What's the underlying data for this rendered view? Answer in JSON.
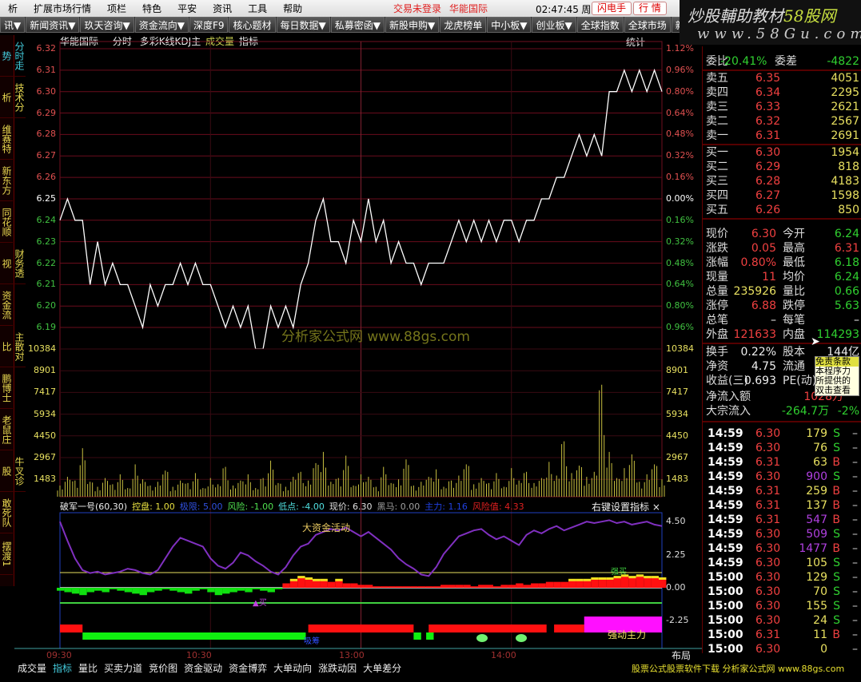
{
  "menubar": {
    "items": [
      "析",
      "扩展市场行情",
      "项栏",
      "特色",
      "平安",
      "资讯",
      "工具",
      "帮助"
    ],
    "status": "交易未登录",
    "stock": "华能国际",
    "time": "02:47:45",
    "weekday": "周日",
    "btn_flash": "闪电手",
    "btn_quote": "行 情"
  },
  "toolbar": {
    "items": [
      "讯▼",
      "新闻资讯▼",
      "玖天咨询▼",
      "资金流向▼",
      "深度F9",
      "核心题材",
      "每日数据▼",
      "私募密函▼",
      "新股申购▼",
      "龙虎榜单",
      "中小板▼",
      "创业板▼",
      "全球指数",
      "全球市场",
      "新"
    ]
  },
  "watermark": {
    "line1a": "炒股輔助教材",
    "line1b": "58股网",
    "line2": "www.58Gu.com"
  },
  "sidebar": [
    "分时走势",
    "技术分析",
    "维赛特",
    "新东方",
    "同花顺",
    "财务透视",
    "资金流",
    "主散对比",
    "鹏博士",
    "老鼠庄",
    "牛叉诊股",
    "敢死队",
    "摆渡1"
  ],
  "chart_header": {
    "name": "华能国际",
    "mode": "分时",
    "kline": "多彩K线KDJ主",
    "volume": "成交量",
    "indicator": "指标",
    "stats": "统计"
  },
  "chart_data": [
    {
      "type": "line",
      "title": "华能国际 分时",
      "prev_close": 6.25,
      "ylim": [
        6.18,
        6.32
      ],
      "price_ticks": [
        "6.32",
        "6.31",
        "6.30",
        "6.29",
        "6.28",
        "6.27",
        "6.26",
        "6.25",
        "6.24",
        "6.23",
        "6.22",
        "6.21",
        "6.20",
        "6.19"
      ],
      "pct_ticks": [
        "1.12%",
        "0.96%",
        "0.80%",
        "0.64%",
        "0.48%",
        "0.32%",
        "0.16%",
        "0.00%",
        "0.16%",
        "0.32%",
        "0.48%",
        "0.64%",
        "0.80%",
        "0.96%"
      ],
      "minutes_step": 3,
      "prices": [
        6.24,
        6.25,
        6.24,
        6.24,
        6.21,
        6.23,
        6.21,
        6.22,
        6.21,
        6.21,
        6.2,
        6.19,
        6.21,
        6.2,
        6.21,
        6.21,
        6.22,
        6.21,
        6.22,
        6.21,
        6.21,
        6.2,
        6.19,
        6.2,
        6.19,
        6.2,
        6.18,
        6.18,
        6.2,
        6.19,
        6.2,
        6.19,
        6.21,
        6.22,
        6.24,
        6.25,
        6.23,
        6.23,
        6.22,
        6.24,
        6.23,
        6.25,
        6.23,
        6.24,
        6.22,
        6.23,
        6.22,
        6.22,
        6.21,
        6.22,
        6.22,
        6.22,
        6.23,
        6.24,
        6.23,
        6.24,
        6.23,
        6.24,
        6.23,
        6.24,
        6.24,
        6.23,
        6.24,
        6.24,
        6.25,
        6.25,
        6.26,
        6.26,
        6.27,
        6.28,
        6.27,
        6.28,
        6.27,
        6.3,
        6.3,
        6.31,
        6.3,
        6.31,
        6.3,
        6.31,
        6.3
      ],
      "x_ticks": [
        "09:30",
        "10:30",
        "13:00",
        "14:00"
      ]
    },
    {
      "type": "bar",
      "title": "成交量",
      "ylim": [
        0,
        11867
      ],
      "ticks": [
        "10384",
        "8901",
        "7417",
        "5934",
        "4450",
        "2967",
        "1483"
      ],
      "values": [
        900,
        1600,
        1300,
        3900,
        1200,
        800,
        1500,
        1000,
        1800,
        700,
        2600,
        1400,
        900,
        1200,
        2100,
        800,
        1300,
        1100,
        1900,
        700,
        1500,
        1000,
        2400,
        900,
        1300,
        1800,
        700,
        1500,
        2900,
        1100,
        800,
        1600,
        2000,
        1300,
        2700,
        3600,
        1200,
        1500,
        3300,
        900,
        1800,
        1600,
        800,
        2400,
        1100,
        1400,
        3000,
        900,
        1200,
        1600,
        2200,
        800,
        1300,
        1700,
        2600,
        1000,
        1500,
        1100,
        1900,
        800,
        2300,
        1300,
        2000,
        1100,
        1500,
        2800,
        1700,
        4450,
        1900,
        2500,
        1600,
        2000,
        9000,
        3600,
        1500,
        2300,
        3400,
        1200,
        1800,
        2600,
        1400
      ]
    },
    {
      "type": "line",
      "title": "破军一号(60,30)",
      "ylim": [
        -3,
        5
      ],
      "ticks": [
        "4.50",
        "2.25",
        "0.00",
        "-2.25"
      ],
      "legend": [
        {
          "k": "控盘",
          "v": "1.00",
          "c": "#e8e040"
        },
        {
          "k": "极限",
          "v": "5.00",
          "c": "#3050e0"
        },
        {
          "k": "风险",
          "v": "-1.00",
          "c": "#50e050"
        },
        {
          "k": "低点",
          "v": "-4.00",
          "c": "#50e0e0"
        },
        {
          "k": "现价",
          "v": "6.30",
          "c": "#e0e0e0"
        },
        {
          "k": "黑马",
          "v": "0.00",
          "c": "#a0a0a0"
        },
        {
          "k": "主力",
          "v": "1.16",
          "c": "#2040e0"
        },
        {
          "k": "风险值",
          "v": "4.33",
          "c": "#e02020"
        }
      ],
      "right_hint": "右键设置指标 ×",
      "line": [
        4.5,
        3.2,
        2.0,
        1.2,
        1.0,
        1.1,
        0.9,
        1.0,
        1.1,
        1.3,
        1.2,
        1.0,
        0.9,
        1.2,
        2.0,
        2.8,
        3.4,
        3.2,
        3.0,
        2.8,
        2.0,
        1.5,
        1.3,
        1.7,
        2.4,
        2.2,
        1.8,
        1.5,
        1.1,
        0.9,
        1.4,
        2.2,
        2.8,
        3.0,
        3.6,
        3.8,
        4.0,
        3.9,
        4.1,
        3.8,
        3.5,
        3.8,
        3.4,
        3.0,
        2.6,
        2.0,
        1.6,
        1.3,
        0.9,
        0.8,
        1.4,
        2.3,
        2.9,
        3.5,
        3.7,
        3.9,
        4.0,
        3.6,
        3.3,
        3.5,
        3.2,
        2.9,
        3.6,
        3.9,
        3.7,
        4.0,
        4.2,
        3.9,
        4.1,
        4.3,
        4.5,
        4.4,
        4.5,
        4.6,
        4.4,
        4.5,
        4.3,
        4.4,
        4.5,
        4.3,
        4.2
      ],
      "fund": [
        -0.2,
        -0.3,
        -0.4,
        -0.5,
        -0.3,
        -0.2,
        -0.3,
        -0.1,
        -0.2,
        -0.3,
        -0.4,
        -0.5,
        -0.3,
        -0.2,
        -0.1,
        -0.2,
        -0.3,
        -0.4,
        -0.2,
        -0.1,
        -0.3,
        -0.5,
        -0.4,
        -0.3,
        -0.2,
        -0.3,
        -0.1,
        -0.2,
        -0.3,
        -0.1,
        0.3,
        0.5,
        0.7,
        0.6,
        0.5,
        0.5,
        0.4,
        0.5,
        0.3,
        0.3,
        0.2,
        0.2,
        0.1,
        0.1,
        0.1,
        0.1,
        0.1,
        0.1,
        0.1,
        0.1,
        0.1,
        0.2,
        0.2,
        0.2,
        0.2,
        0.1,
        0.2,
        0.2,
        0.1,
        0.2,
        0.2,
        0.3,
        0.2,
        0.3,
        0.3,
        0.4,
        0.4,
        0.4,
        0.5,
        0.5,
        0.5,
        0.6,
        0.6,
        0.6,
        0.7,
        0.8,
        0.7,
        0.8,
        0.7,
        0.7,
        0.6
      ],
      "band_top": [
        {
          "from": 0,
          "to": 9,
          "color": "#ff1010"
        },
        {
          "from": 99,
          "to": 141,
          "color": "#ff1010"
        },
        {
          "from": 147,
          "to": 194,
          "color": "#ff1010"
        },
        {
          "from": 197,
          "to": 209,
          "color": "#ff1010"
        },
        {
          "from": 209,
          "to": 240,
          "color": "#ff10ff"
        }
      ],
      "band_bottom": [
        {
          "from": 9,
          "to": 98,
          "color": "#10f010"
        },
        {
          "from": 141,
          "to": 144,
          "color": "#10f010"
        },
        {
          "from": 146,
          "to": 149,
          "color": "#10f010"
        }
      ],
      "annotations": {
        "big_fund": "大资金活动",
        "buy": "强买",
        "strong": "强动主力",
        "bottom_buy": "买",
        "absorb": "吸筹"
      }
    }
  ],
  "right_panel": {
    "weibi": {
      "label": "委比",
      "value": "-20.41%",
      "label2": "委差",
      "value2": "-4822"
    },
    "asks": [
      {
        "l": "卖五",
        "p": "6.35",
        "v": "4051"
      },
      {
        "l": "卖四",
        "p": "6.34",
        "v": "2295"
      },
      {
        "l": "卖三",
        "p": "6.33",
        "v": "2621"
      },
      {
        "l": "卖二",
        "p": "6.32",
        "v": "2567"
      },
      {
        "l": "卖一",
        "p": "6.31",
        "v": "2691"
      }
    ],
    "bids": [
      {
        "l": "买一",
        "p": "6.30",
        "v": "1954"
      },
      {
        "l": "买二",
        "p": "6.29",
        "v": "818"
      },
      {
        "l": "买三",
        "p": "6.28",
        "v": "4183"
      },
      {
        "l": "买四",
        "p": "6.27",
        "v": "1598"
      },
      {
        "l": "买五",
        "p": "6.26",
        "v": "850"
      }
    ],
    "stats": [
      {
        "l": "现价",
        "v": "6.30",
        "c": "#f04040",
        "l2": "今开",
        "v2": "6.24",
        "c2": "#30d030"
      },
      {
        "l": "涨跌",
        "v": "0.05",
        "c": "#f04040",
        "l2": "最高",
        "v2": "6.31",
        "c2": "#f04040"
      },
      {
        "l": "涨幅",
        "v": "0.80%",
        "c": "#f04040",
        "l2": "最低",
        "v2": "6.18",
        "c2": "#30d030"
      },
      {
        "l": "现量",
        "v": "11",
        "c": "#f04040",
        "l2": "均价",
        "v2": "6.24",
        "c2": "#30d030"
      },
      {
        "l": "总量",
        "v": "235926",
        "c": "#e8e060",
        "l2": "量比",
        "v2": "0.66",
        "c2": "#30d030"
      },
      {
        "l": "涨停",
        "v": "6.88",
        "c": "#f04040",
        "l2": "跌停",
        "v2": "5.63",
        "c2": "#30d030"
      },
      {
        "l": "总笔",
        "v": "–",
        "c": "#eee",
        "l2": "每笔",
        "v2": "–",
        "c2": "#eee"
      },
      {
        "l": "外盘",
        "v": "121633",
        "c": "#f04040",
        "l2": "内盘",
        "v2": "114293",
        "c2": "#30d030"
      }
    ],
    "stats2": [
      {
        "l": "换手",
        "v": "0.22%",
        "l2": "股本",
        "v2": "144亿"
      },
      {
        "l": "净资",
        "v": "4.75",
        "l2": "流通",
        "v2": ""
      },
      {
        "l": "收益(三)",
        "v": "0.693",
        "l2": "PE(动)",
        "v2": ""
      }
    ],
    "netflow": {
      "label": "净流入额",
      "value": "1028万"
    },
    "block": {
      "label": "大宗流入",
      "value": "-264.7万",
      "pct": "-2%"
    },
    "tooltip": [
      "免责条款",
      "本程序力",
      "所提供的",
      "双击查看"
    ],
    "ticks": [
      {
        "t": "14:59",
        "p": "6.30",
        "v": "179",
        "s": "S"
      },
      {
        "t": "14:59",
        "p": "6.30",
        "v": "76",
        "s": "S"
      },
      {
        "t": "14:59",
        "p": "6.31",
        "v": "63",
        "s": "B"
      },
      {
        "t": "14:59",
        "p": "6.30",
        "v": "900",
        "s": "S",
        "big": true
      },
      {
        "t": "14:59",
        "p": "6.31",
        "v": "259",
        "s": "B"
      },
      {
        "t": "14:59",
        "p": "6.31",
        "v": "137",
        "s": "B"
      },
      {
        "t": "14:59",
        "p": "6.31",
        "v": "547",
        "s": "B",
        "big": true
      },
      {
        "t": "14:59",
        "p": "6.30",
        "v": "509",
        "s": "S",
        "big": true
      },
      {
        "t": "14:59",
        "p": "6.30",
        "v": "1477",
        "s": "B",
        "big": true
      },
      {
        "t": "14:59",
        "p": "6.30",
        "v": "105",
        "s": "S"
      },
      {
        "t": "15:00",
        "p": "6.30",
        "v": "129",
        "s": "S"
      },
      {
        "t": "15:00",
        "p": "6.30",
        "v": "70",
        "s": "S"
      },
      {
        "t": "15:00",
        "p": "6.30",
        "v": "155",
        "s": "S"
      },
      {
        "t": "15:00",
        "p": "6.30",
        "v": "24",
        "s": "S"
      },
      {
        "t": "15:00",
        "p": "6.31",
        "v": "11",
        "s": "B"
      },
      {
        "t": "15:00",
        "p": "6.30",
        "v": "0",
        "s": ""
      }
    ]
  },
  "layout_btn": "布局",
  "bottom_tabs": [
    "成交量",
    "指标",
    "量比",
    "买卖力道",
    "竞价图",
    "资金驱动",
    "资金博弈",
    "大单动向",
    "涨跌动因",
    "大单差分"
  ],
  "footer_ad": "股票公式股票软件下载 分析家公式网 www.88gs.com",
  "chart_watermark": "分析家公式网  www.88gs.com",
  "colors": {
    "up": "#f04040",
    "down": "#30d030",
    "grid": "#701020",
    "accent": "#4cd"
  }
}
